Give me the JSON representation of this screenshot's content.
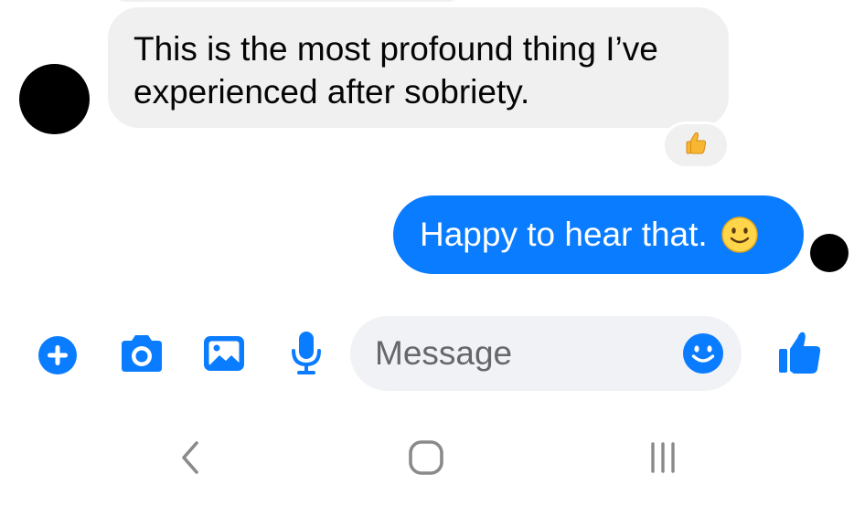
{
  "conversation": {
    "incoming_text": "This is the most profound thing I’ve experienced after sobriety.",
    "outgoing_text": "Happy to hear that."
  },
  "composer": {
    "placeholder": "Message"
  },
  "icons": {
    "reaction": "thumbs-up-emoji",
    "outgoing_emoji": "slightly-smiling-face-emoji",
    "add": "plus-circle-icon",
    "camera": "camera-icon",
    "gallery": "image-icon",
    "mic": "microphone-icon",
    "emoji": "smiley-icon",
    "like": "thumbs-up-icon",
    "nav_back": "chevron-left-icon",
    "nav_home": "rounded-square-icon",
    "nav_recents": "three-bars-icon"
  },
  "colors": {
    "accent": "#0a7cff",
    "incoming_bubble": "#f0f0f0",
    "input_bg": "#f0f2f5",
    "placeholder": "#65676b",
    "nav_icons": "#8a8a8a"
  }
}
